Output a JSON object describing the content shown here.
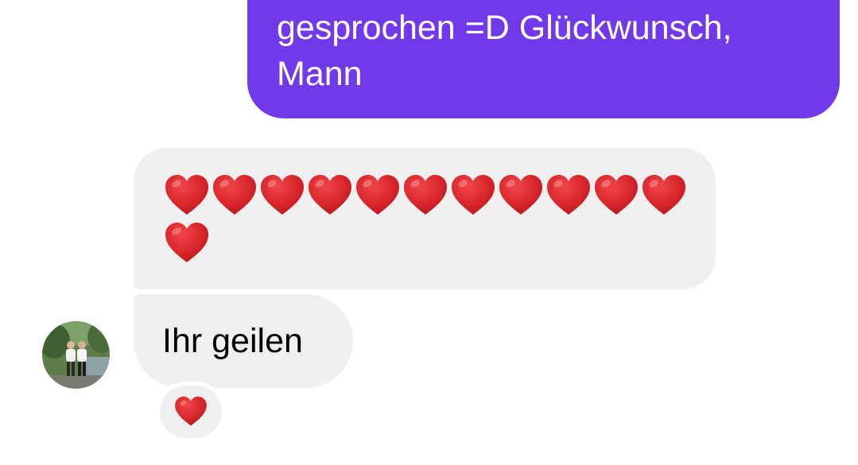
{
  "messages": {
    "sent": {
      "text": "gesprochen =D Glückwunsch, Mann",
      "bubble_color": "#7239EA"
    },
    "received": [
      {
        "type": "emoji",
        "content_icon": "red-heart-icon",
        "count": 12
      },
      {
        "type": "text",
        "text": "Ihr geilen"
      }
    ]
  },
  "reaction": {
    "icon": "red-heart-icon"
  },
  "avatar": {
    "icon": "profile-photo"
  },
  "colors": {
    "received_bubble": "#EFEFEF",
    "heart": "#D9262B"
  }
}
